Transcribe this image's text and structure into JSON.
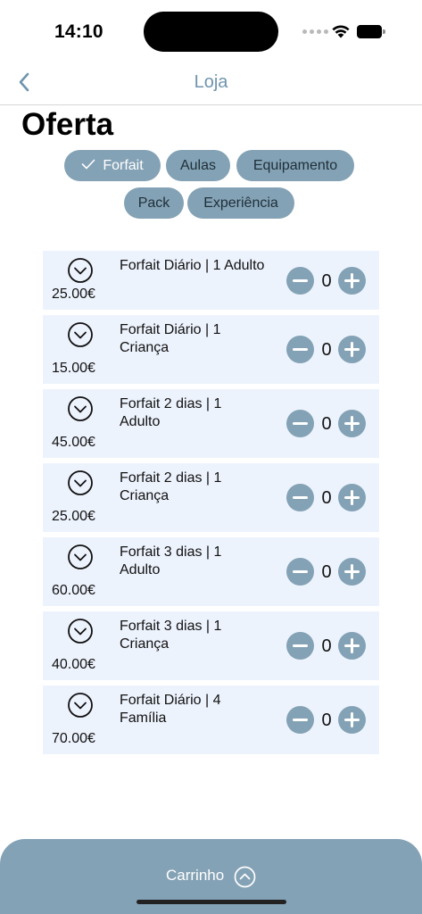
{
  "status": {
    "time": "14:10"
  },
  "nav": {
    "title": "Loja",
    "back_icon": "chevron-left-icon"
  },
  "page": {
    "title": "Oferta"
  },
  "filters": [
    {
      "label": "Forfait",
      "selected": true
    },
    {
      "label": "Aulas",
      "selected": false
    },
    {
      "label": "Equipamento",
      "selected": false
    },
    {
      "label": "Pack",
      "selected": false
    },
    {
      "label": "Experiência",
      "selected": false
    }
  ],
  "products": [
    {
      "name": "Forfait Diário | 1 Adulto",
      "price": "25.00€",
      "quantity": "0"
    },
    {
      "name": "Forfait Diário | 1 Criança",
      "price": "15.00€",
      "quantity": "0"
    },
    {
      "name": "Forfait 2 dias | 1 Adulto",
      "price": "45.00€",
      "quantity": "0"
    },
    {
      "name": "Forfait 2 dias | 1 Criança",
      "price": "25.00€",
      "quantity": "0"
    },
    {
      "name": "Forfait 3 dias | 1 Adulto",
      "price": "60.00€",
      "quantity": "0"
    },
    {
      "name": "Forfait 3 dias | 1 Criança",
      "price": "40.00€",
      "quantity": "0"
    },
    {
      "name": "Forfait Diário | 4 Família",
      "price": "70.00€",
      "quantity": "0"
    }
  ],
  "cart": {
    "label": "Carrinho",
    "icon": "chevron-up-circle-icon"
  },
  "colors": {
    "accent": "#84a2b5",
    "row_background": "#edf3fd",
    "nav_title": "#6f95ad"
  }
}
